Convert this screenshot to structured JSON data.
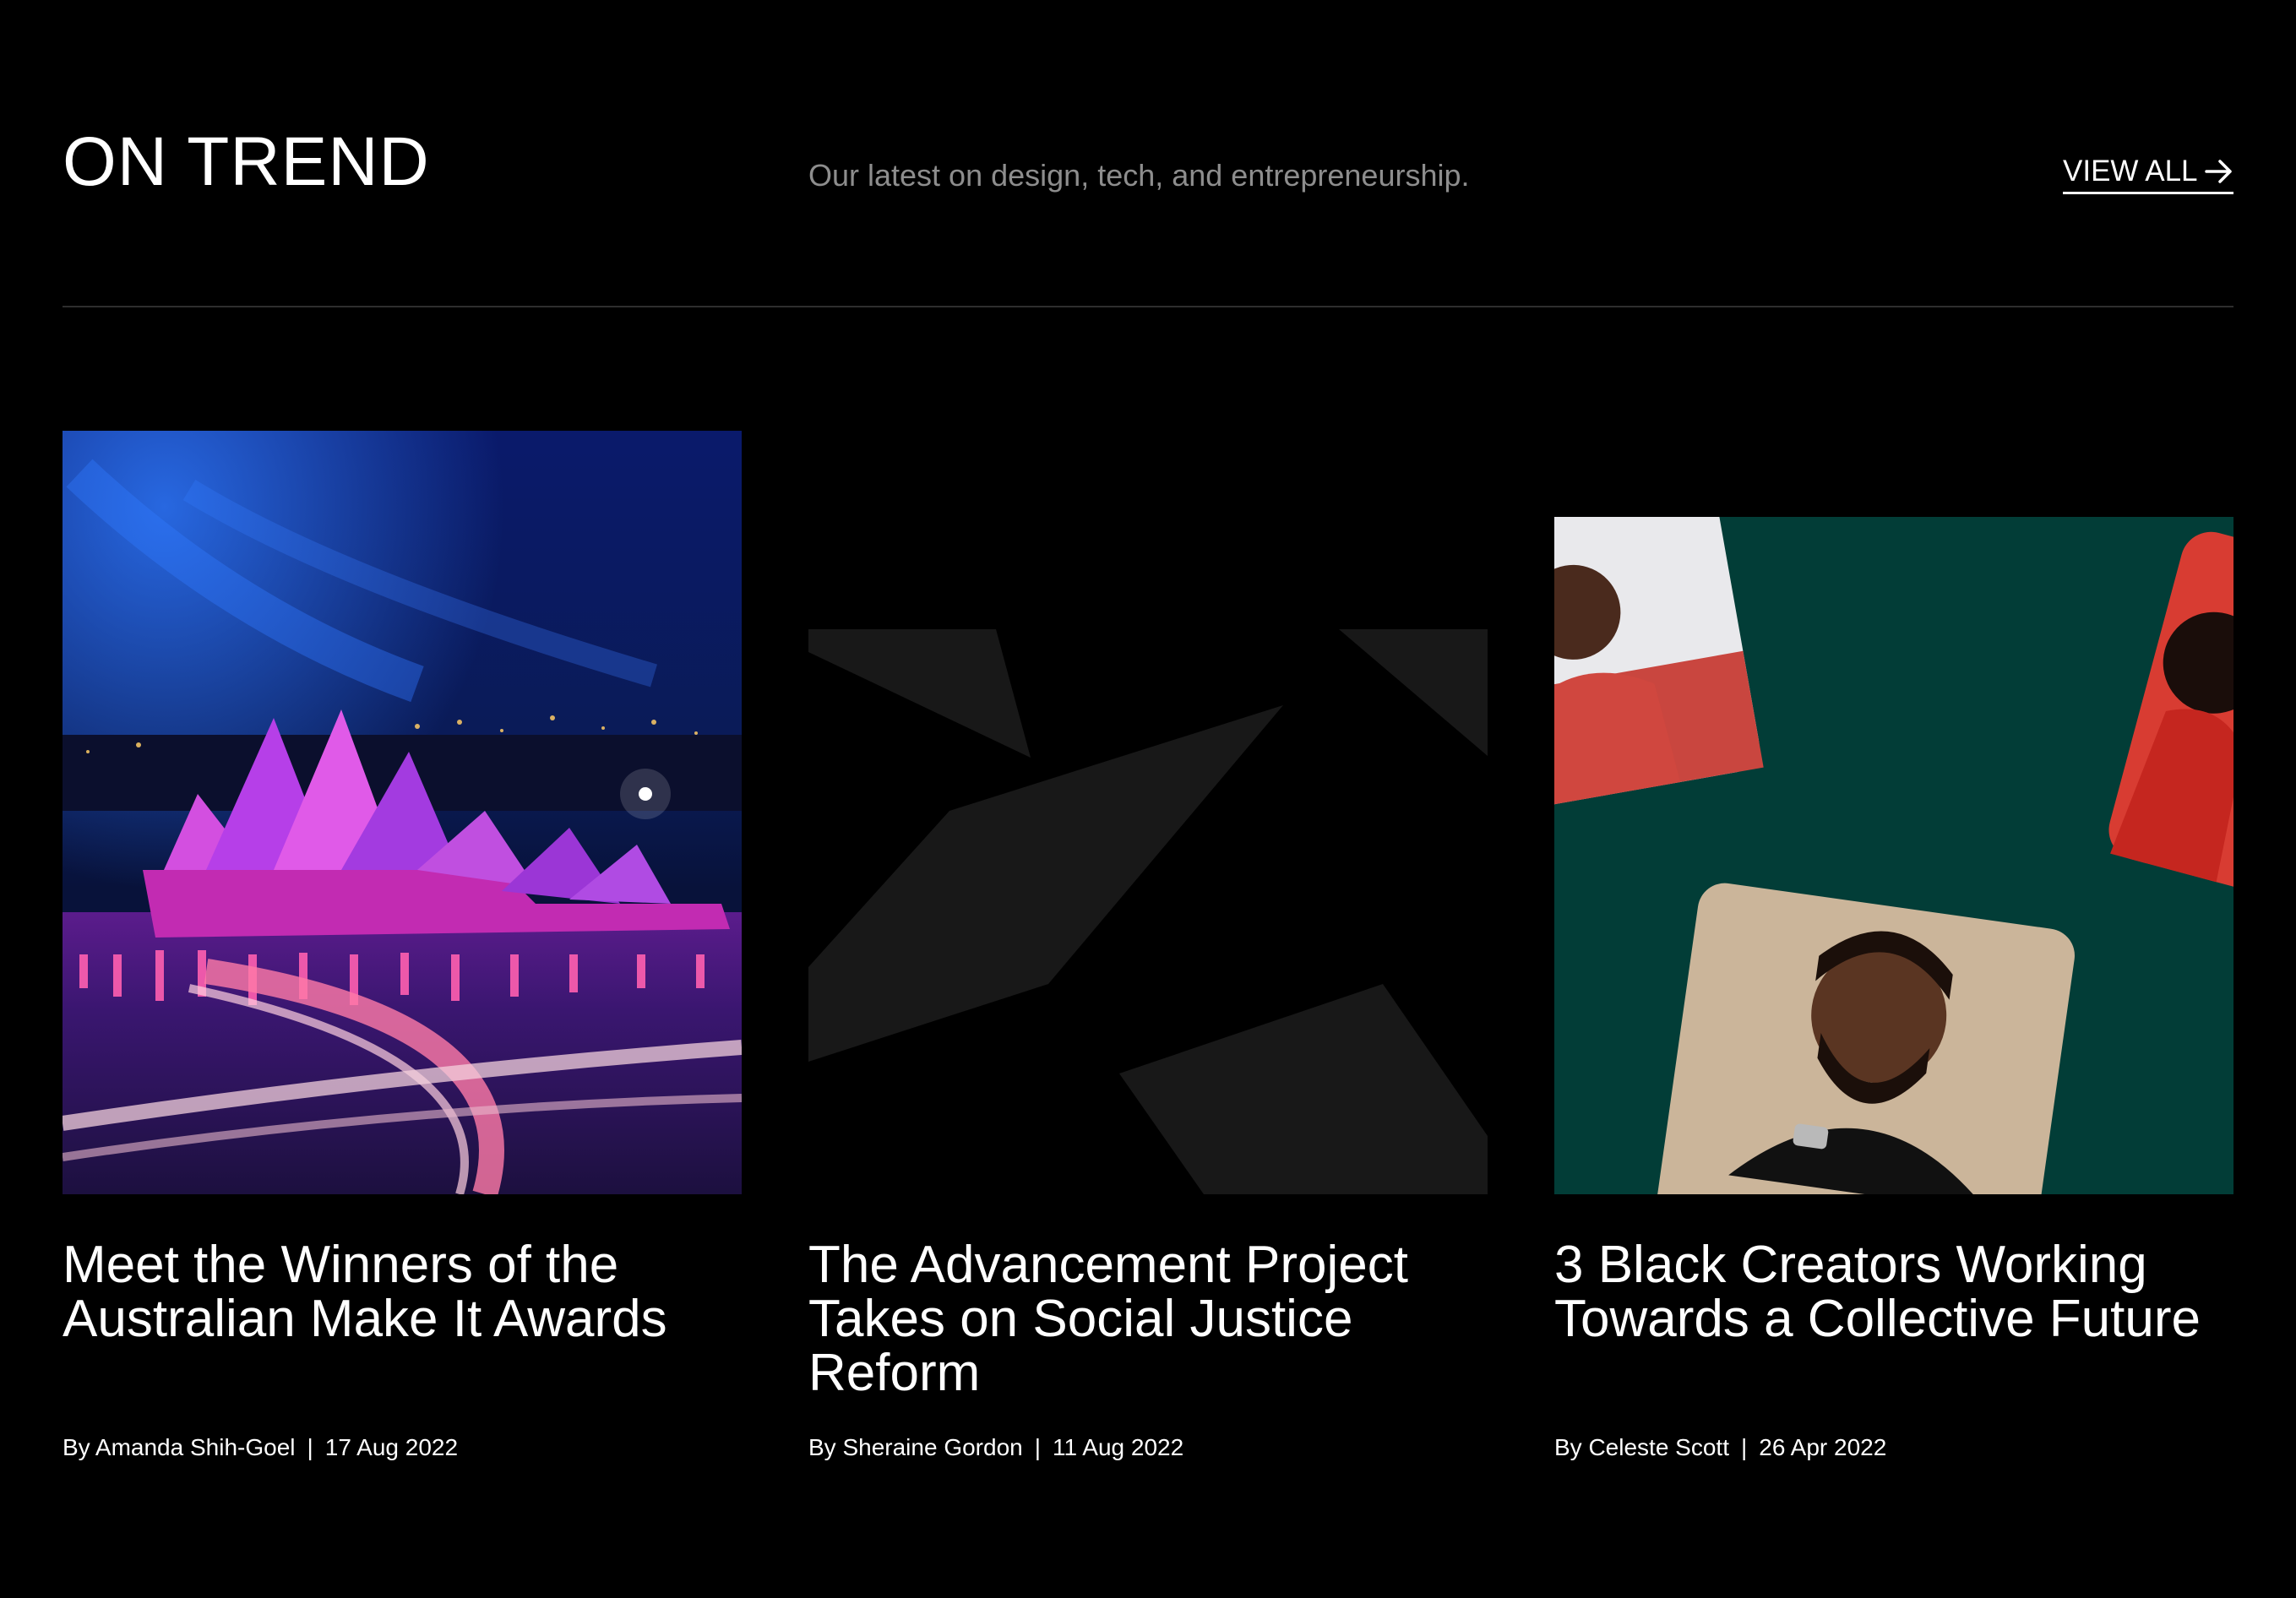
{
  "section": {
    "title": "ON TREND",
    "subtitle": "Our latest on design, tech, and entrepreneurship.",
    "view_all_label": "VIEW ALL"
  },
  "articles": [
    {
      "title": "Meet the Winners of the Australian Make It Awards",
      "author": "By Amanda Shih-Goel",
      "separator": "|",
      "date": "17 Aug 2022"
    },
    {
      "title": "The Advancement Project Takes on Social Justice Reform",
      "author": "By Sheraine Gordon",
      "separator": "|",
      "date": "11 Aug 2022"
    },
    {
      "title": "3 Black Creators Working Towards a Collective Future",
      "author": "By Celeste Scott",
      "separator": "|",
      "date": "26 Apr 2022"
    }
  ],
  "colors": {
    "background": "#000000",
    "subtitle_gray": "#8d8d8d",
    "divider": "#2e2e2e",
    "card3_teal": "#023d37",
    "logo_shape_gray": "#181818"
  },
  "icons": {
    "view_all": "arrow-right-icon"
  }
}
